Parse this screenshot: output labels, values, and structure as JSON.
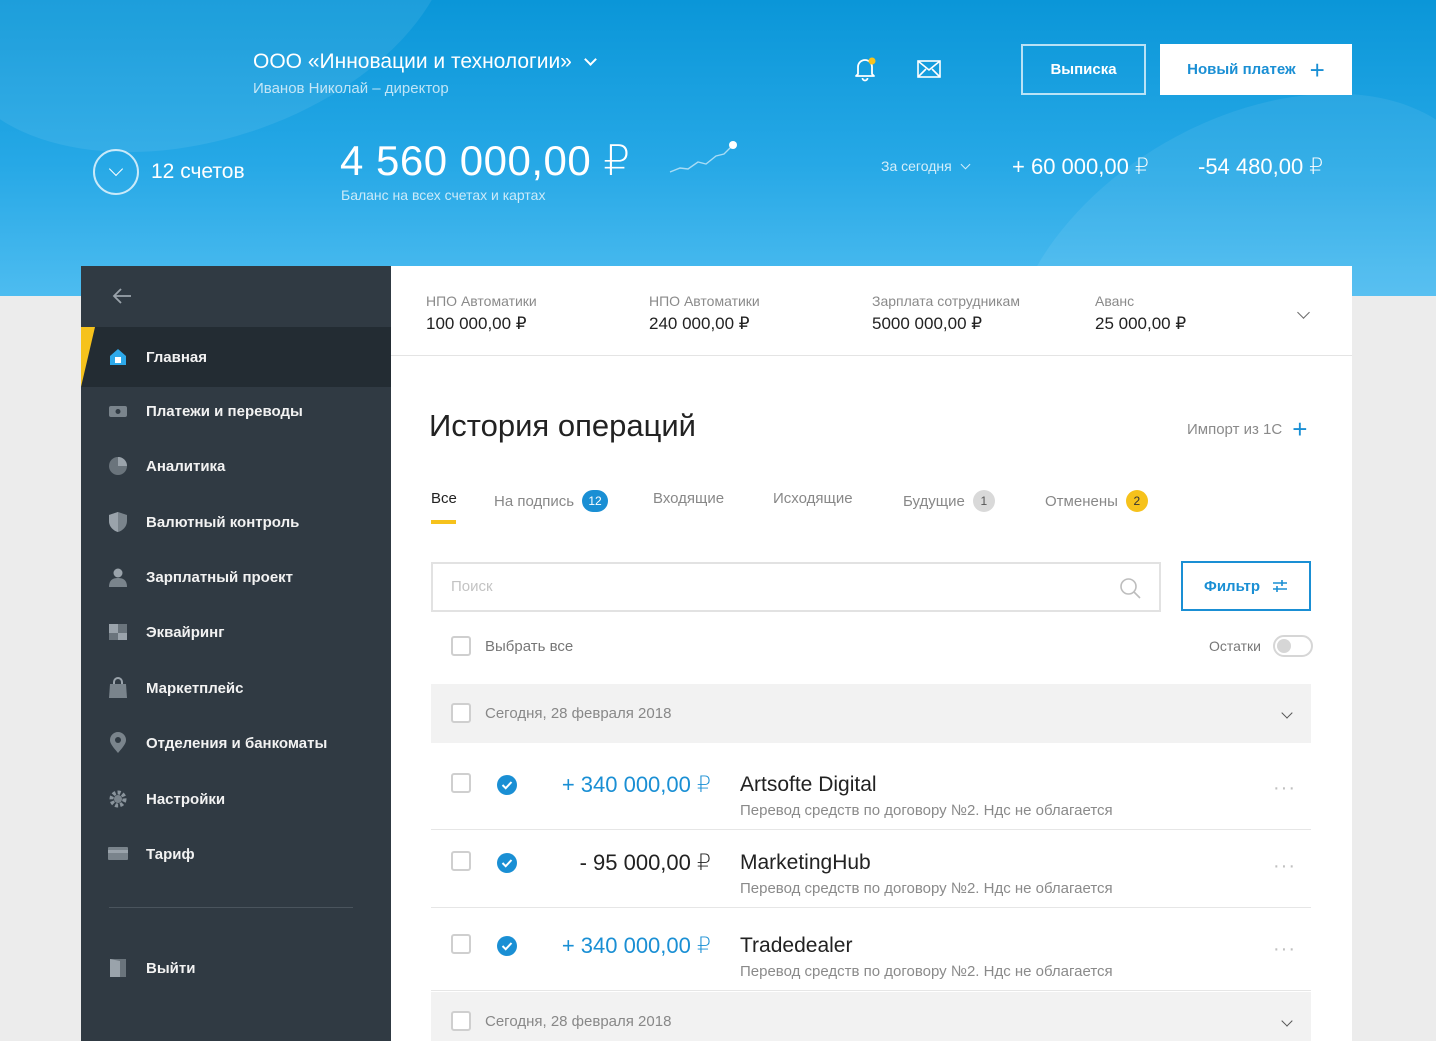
{
  "header": {
    "company": "ООО «Инновации и технологии»",
    "user": "Иванов Николай – директор",
    "statement_button": "Выписка",
    "new_payment_button": "Новый платеж",
    "accounts_count": "12 счетов",
    "balance": "4 560 000,00 ₽",
    "balance_caption": "Баланс на всех счетах и картах",
    "period": "За сегодня",
    "income": "+ 60 000,00 ₽",
    "outcome": "-54 480,00 ₽"
  },
  "sidebar": {
    "items": [
      {
        "label": "Главная",
        "icon": "home-icon",
        "active": true
      },
      {
        "label": "Платежи и переводы",
        "icon": "wallet-icon"
      },
      {
        "label": "Аналитика",
        "icon": "pie-chart-icon"
      },
      {
        "label": "Валютный контроль",
        "icon": "shield-icon"
      },
      {
        "label": "Зарплатный проект",
        "icon": "user-icon"
      },
      {
        "label": "Эквайринг",
        "icon": "terminal-icon"
      },
      {
        "label": "Маркетплейс",
        "icon": "shopping-bag-icon"
      },
      {
        "label": "Отделения и банкоматы",
        "icon": "map-pin-icon"
      },
      {
        "label": "Настройки",
        "icon": "gear-icon"
      },
      {
        "label": "Тариф",
        "icon": "card-icon"
      }
    ],
    "logout": "Выйти"
  },
  "quick": [
    {
      "name": "НПО Автоматики",
      "value": "100 000,00 ₽"
    },
    {
      "name": "НПО Автоматики",
      "value": "240 000,00 ₽"
    },
    {
      "name": "Зарплата сотрудникам",
      "value": "5000 000,00 ₽"
    },
    {
      "name": "Аванс",
      "value": "25 000,00 ₽"
    }
  ],
  "history": {
    "title": "История операций",
    "import_label": "Импорт из 1С",
    "tabs": [
      {
        "label": "Все",
        "badge": ""
      },
      {
        "label": "На подпись",
        "badge": "12"
      },
      {
        "label": "Входящие",
        "badge": ""
      },
      {
        "label": "Исходящие",
        "badge": ""
      },
      {
        "label": "Будущие",
        "badge": "1"
      },
      {
        "label": "Отменены",
        "badge": "2"
      }
    ],
    "search_placeholder": "Поиск",
    "filter_button": "Фильтр",
    "select_all": "Выбрать все",
    "remains_label": "Остатки",
    "groups": [
      {
        "date": "Сегодня, 28 февраля 2018"
      },
      {
        "date": "Сегодня, 28 февраля 2018"
      }
    ],
    "operations": [
      {
        "amount": "+ 340 000,00 ₽",
        "name": "Artsofte Digital",
        "description": "Перевод средств по договору №2.  Ндс не облагается"
      },
      {
        "amount": "- 95 000,00 ₽",
        "name": "MarketingHub",
        "description": "Перевод средств по договору №2.  Ндс не облагается"
      },
      {
        "amount": "+ 340 000,00 ₽",
        "name": "Tradedealer",
        "description": "Перевод средств по договору №2.  Ндс не облагается"
      }
    ],
    "more_glyph": "···"
  },
  "colors": {
    "accent": "#1a8fd4",
    "header_blue": "#0a96d8",
    "sidebar": "#303a43",
    "active_marker": "#f6c21c"
  }
}
